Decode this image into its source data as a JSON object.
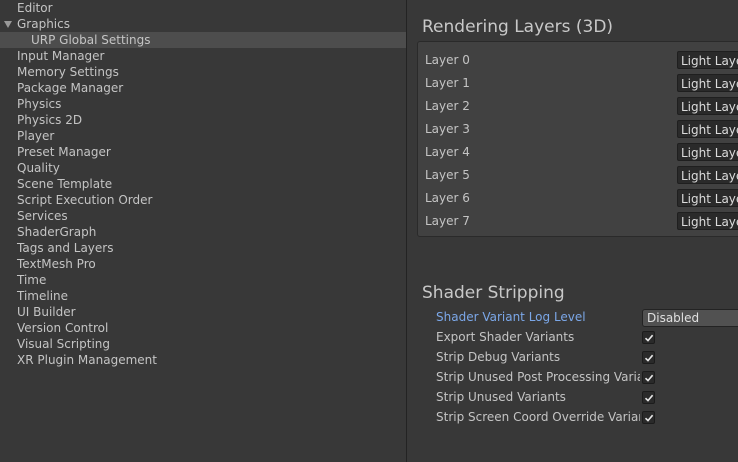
{
  "sidebar": {
    "items": [
      {
        "label": "Editor",
        "indent": 0,
        "selected": false,
        "expandable": false
      },
      {
        "label": "Graphics",
        "indent": 0,
        "selected": false,
        "expandable": true
      },
      {
        "label": "URP Global Settings",
        "indent": 1,
        "selected": true,
        "expandable": false
      },
      {
        "label": "Input Manager",
        "indent": 0,
        "selected": false,
        "expandable": false
      },
      {
        "label": "Memory Settings",
        "indent": 0,
        "selected": false,
        "expandable": false
      },
      {
        "label": "Package Manager",
        "indent": 0,
        "selected": false,
        "expandable": false
      },
      {
        "label": "Physics",
        "indent": 0,
        "selected": false,
        "expandable": false
      },
      {
        "label": "Physics 2D",
        "indent": 0,
        "selected": false,
        "expandable": false
      },
      {
        "label": "Player",
        "indent": 0,
        "selected": false,
        "expandable": false
      },
      {
        "label": "Preset Manager",
        "indent": 0,
        "selected": false,
        "expandable": false
      },
      {
        "label": "Quality",
        "indent": 0,
        "selected": false,
        "expandable": false
      },
      {
        "label": "Scene Template",
        "indent": 0,
        "selected": false,
        "expandable": false
      },
      {
        "label": "Script Execution Order",
        "indent": 0,
        "selected": false,
        "expandable": false
      },
      {
        "label": "Services",
        "indent": 0,
        "selected": false,
        "expandable": false
      },
      {
        "label": "ShaderGraph",
        "indent": 0,
        "selected": false,
        "expandable": false
      },
      {
        "label": "Tags and Layers",
        "indent": 0,
        "selected": false,
        "expandable": false
      },
      {
        "label": "TextMesh Pro",
        "indent": 0,
        "selected": false,
        "expandable": false
      },
      {
        "label": "Time",
        "indent": 0,
        "selected": false,
        "expandable": false
      },
      {
        "label": "Timeline",
        "indent": 0,
        "selected": false,
        "expandable": false
      },
      {
        "label": "UI Builder",
        "indent": 0,
        "selected": false,
        "expandable": false
      },
      {
        "label": "Version Control",
        "indent": 0,
        "selected": false,
        "expandable": false
      },
      {
        "label": "Visual Scripting",
        "indent": 0,
        "selected": false,
        "expandable": false
      },
      {
        "label": "XR Plugin Management",
        "indent": 0,
        "selected": false,
        "expandable": false
      }
    ]
  },
  "rendering_layers": {
    "title": "Rendering Layers (3D)",
    "layers": [
      {
        "label": "Layer 0",
        "value": "Light Layer"
      },
      {
        "label": "Layer 1",
        "value": "Light Layer"
      },
      {
        "label": "Layer 2",
        "value": "Light Layer"
      },
      {
        "label": "Layer 3",
        "value": "Light Layer"
      },
      {
        "label": "Layer 4",
        "value": "Light Layer"
      },
      {
        "label": "Layer 5",
        "value": "Light Layer"
      },
      {
        "label": "Layer 6",
        "value": "Light Layer"
      },
      {
        "label": "Layer 7",
        "value": "Light Layer"
      }
    ]
  },
  "shader_stripping": {
    "title": "Shader Stripping",
    "log_level": {
      "label": "Shader Variant Log Level",
      "value": "Disabled"
    },
    "options": [
      {
        "label": "Export Shader Variants",
        "checked": true
      },
      {
        "label": "Strip Debug Variants",
        "checked": true
      },
      {
        "label": "Strip Unused Post Processing Variants",
        "checked": true
      },
      {
        "label": "Strip Unused Variants",
        "checked": true
      },
      {
        "label": "Strip Screen Coord Override Variants",
        "checked": true
      }
    ]
  },
  "colors": {
    "link": "#7ba7e8",
    "background": "#383838",
    "selected": "#4d4d4d"
  },
  "icons": {
    "expand": "triangle-down-icon",
    "check": "checkmark-icon"
  }
}
